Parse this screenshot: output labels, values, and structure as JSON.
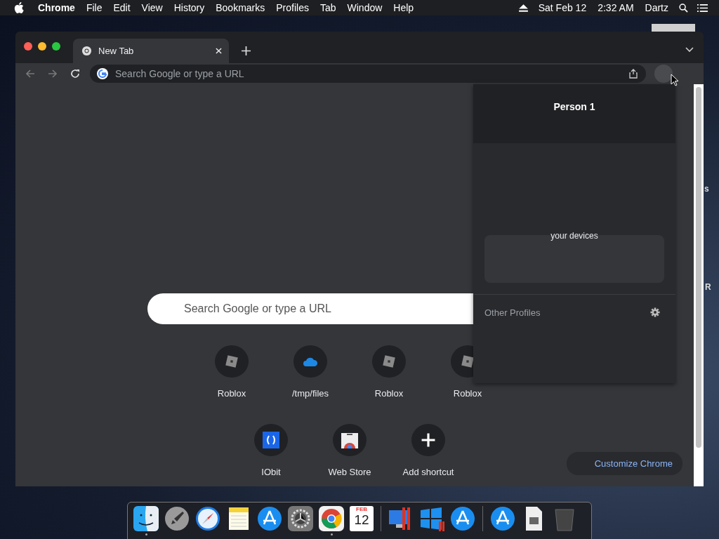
{
  "menubar": {
    "app": "Chrome",
    "menus": [
      "File",
      "Edit",
      "View",
      "History",
      "Bookmarks",
      "Profiles",
      "Tab",
      "Window",
      "Help"
    ],
    "date": "Sat Feb 12",
    "time": "2:32 AM",
    "user": "Dartz"
  },
  "desktop": {
    "fragments": [
      "s",
      "R"
    ]
  },
  "browser": {
    "tabs": [
      {
        "title": "New Tab",
        "selected": true
      }
    ],
    "address": {
      "placeholder": "Search Google or type a URL"
    },
    "search": {
      "placeholder": "Search Google or type a URL"
    },
    "shortcut_rows": [
      [
        {
          "label": "Roblox",
          "kind": "roblox"
        },
        {
          "label": "/tmp/files",
          "kind": "cloud"
        },
        {
          "label": "Roblox",
          "kind": "roblox"
        },
        {
          "label": "Roblox",
          "kind": "roblox"
        }
      ],
      [
        {
          "label": "IObit",
          "kind": "iobit"
        },
        {
          "label": "Web Store",
          "kind": "webstore"
        },
        {
          "label": "Add shortcut",
          "kind": "add"
        }
      ]
    ],
    "customize": "Customize Chrome"
  },
  "profile_panel": {
    "name": "Person 1",
    "sync_text": "your devices",
    "other_profiles": "Other Profiles"
  },
  "dock": [
    {
      "kind": "finder",
      "running": true
    },
    {
      "kind": "launchpad",
      "running": false
    },
    {
      "kind": "safari",
      "running": false
    },
    {
      "kind": "notes",
      "running": false
    },
    {
      "kind": "appstore",
      "running": false
    },
    {
      "kind": "settings",
      "running": false
    },
    {
      "kind": "chrome",
      "running": true
    },
    {
      "kind": "calendar",
      "running": false,
      "month": "FEB",
      "day": "12"
    },
    {
      "kind": "separator"
    },
    {
      "kind": "parallels",
      "running": false
    },
    {
      "kind": "windows",
      "running": false
    },
    {
      "kind": "appstore",
      "running": false
    },
    {
      "kind": "separator"
    },
    {
      "kind": "appstore",
      "running": false
    },
    {
      "kind": "file",
      "running": false
    },
    {
      "kind": "trash",
      "running": false
    }
  ]
}
